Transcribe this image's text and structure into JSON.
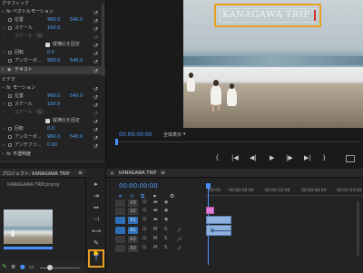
{
  "effect_controls": {
    "section_graphics": "グラフィック",
    "vector_motion": "ベクトルモーション",
    "position_label": "位置",
    "position_x": "960.0",
    "position_y": "540.0",
    "scale_label": "スケール",
    "scale_value": "100.0",
    "scale_width_label": "スケール（幅）",
    "uniform_scale_label": "縦横比を固定",
    "rotation_label": "回転",
    "rotation_value": "0.0",
    "anchor_label": "アンカーポ...",
    "anchor_x": "960.0",
    "anchor_y": "540.0",
    "text_layer": "テキスト",
    "section_video": "ビデオ",
    "motion": "モーション",
    "position2_x": "960.0",
    "position2_y": "540.0",
    "scale2_value": "100.0",
    "scale_width2_label": "スケール（幅）",
    "uniform_scale2_label": "縦横比を固定",
    "rotation2_value": "0.0",
    "anchor2_x": "960.0",
    "anchor2_y": "540.0",
    "antiflicker_label": "アンチフリ...",
    "antiflicker_value": "0.00",
    "opacity_label": "不透明度",
    "fx": "fx",
    "reset_glyph": "↺"
  },
  "monitor": {
    "overlay_title": "KANAGAWA TRIP",
    "timecode": "00:00:00:00",
    "fit_label": "全体表示",
    "transport": [
      "{",
      "|◀",
      "◀|",
      "▶",
      "|▶",
      "▶|",
      "}"
    ]
  },
  "project": {
    "tab_label": "プロジェクト: KANAGAWA TRIP",
    "tab_menu": "≡",
    "file_label": "KANAGAWA TRIP.prproj"
  },
  "timeline": {
    "tab_label": "KANAGAWA TRIP",
    "tab_menu": "≡",
    "timecode": "00:00:00:00",
    "ruler_labels": [
      "00:00",
      "00:00:16:00",
      "00:00:32:00",
      "00:00:48:00",
      "00:01:04:00"
    ],
    "tracks": [
      {
        "name": "V3",
        "kind": "video",
        "active": false
      },
      {
        "name": "V2",
        "kind": "video",
        "active": false
      },
      {
        "name": "V1",
        "kind": "video",
        "active": true
      },
      {
        "name": "A1",
        "kind": "audio",
        "active": true
      },
      {
        "name": "A2",
        "kind": "audio",
        "active": false
      },
      {
        "name": "A3",
        "kind": "audio",
        "active": false
      }
    ],
    "track_toggle_video": "●",
    "track_toggle_audio": "M",
    "track_solo": "S",
    "close_glyph": "×",
    "colors": {
      "graphic_clip": "#e27bd6",
      "video_clip": "#8fb0dc",
      "audio_clip": "#8fb0dc",
      "playhead": "#4a8fff",
      "highlight": "#e8a020"
    }
  },
  "tools": {
    "icons": [
      "▸",
      "⇥",
      "↔",
      "⊣",
      "⟷",
      "✎",
      "✋",
      "T"
    ],
    "selected_index": 7
  }
}
